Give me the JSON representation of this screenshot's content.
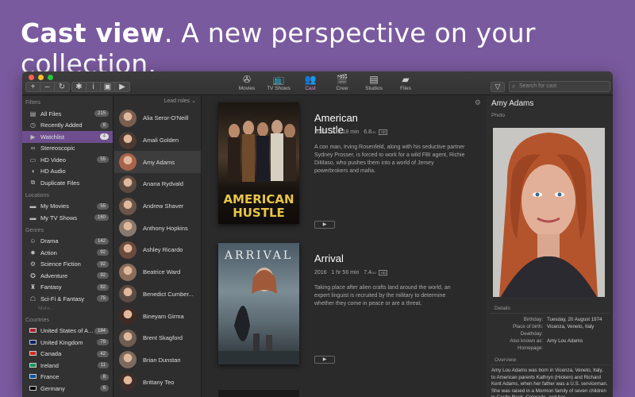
{
  "headline": {
    "bold": "Cast view",
    "rest": ". A new perspective on your collection."
  },
  "toolbar": {
    "left_buttons": [
      "+",
      "–",
      "↻"
    ],
    "right_buttons": [
      "✱",
      "i",
      "▣",
      "▶"
    ],
    "tabs": [
      {
        "label": "Movies",
        "icon": "film-reel-icon",
        "glyph": "✇"
      },
      {
        "label": "TV Shows",
        "icon": "tv-icon",
        "glyph": "📺"
      },
      {
        "label": "Cast",
        "icon": "people-icon",
        "glyph": "👥"
      },
      {
        "label": "Crew",
        "icon": "crew-icon",
        "glyph": "🎬"
      },
      {
        "label": "Studios",
        "icon": "clapper-icon",
        "glyph": "▤"
      },
      {
        "label": "Files",
        "icon": "folder-icon",
        "glyph": "▰"
      }
    ],
    "active_tab": "Cast",
    "search_placeholder": "Search for cast"
  },
  "sidebar": {
    "filters_header": "Filters",
    "filters": [
      {
        "label": "All Files",
        "count": "215",
        "icon": "files-icon",
        "glyph": "▤"
      },
      {
        "label": "Recently Added",
        "count": "8",
        "icon": "clock-icon",
        "glyph": "◷"
      },
      {
        "label": "Watchlist",
        "count": "4",
        "icon": "play-circle-icon",
        "glyph": "▶",
        "selected": true
      },
      {
        "label": "Stereoscopic",
        "count": "",
        "icon": "glasses-icon",
        "glyph": "∞"
      },
      {
        "label": "HD Video",
        "count": "55",
        "icon": "hd-video-icon",
        "glyph": "▭"
      },
      {
        "label": "HD Audio",
        "count": "",
        "icon": "hd-audio-icon",
        "glyph": "◖"
      },
      {
        "label": "Duplicate Files",
        "count": "",
        "icon": "duplicate-icon",
        "glyph": "⧉"
      }
    ],
    "locations_header": "Locations",
    "locations": [
      {
        "label": "My Movies",
        "count": "55",
        "icon": "folder-icon",
        "glyph": "▬"
      },
      {
        "label": "My TV Shows",
        "count": "160",
        "icon": "folder-icon",
        "glyph": "▬"
      }
    ],
    "genres_header": "Genres",
    "genres": [
      {
        "label": "Drama",
        "count": "142",
        "icon": "drama-icon",
        "glyph": "☺"
      },
      {
        "label": "Action",
        "count": "92",
        "icon": "action-icon",
        "glyph": "✸"
      },
      {
        "label": "Science Fiction",
        "count": "92",
        "icon": "scifi-icon",
        "glyph": "⚙"
      },
      {
        "label": "Adventure",
        "count": "92",
        "icon": "compass-icon",
        "glyph": "✪"
      },
      {
        "label": "Fantasy",
        "count": "82",
        "icon": "castle-icon",
        "glyph": "♜"
      },
      {
        "label": "Sci-Fi & Fantasy",
        "count": "75",
        "icon": "robot-icon",
        "glyph": "☖"
      }
    ],
    "genres_more": "More...",
    "countries_header": "Countries",
    "countries": [
      {
        "label": "United States of A...",
        "count": "184",
        "icon": "flag-us-icon",
        "color": "#b22234"
      },
      {
        "label": "United Kingdom",
        "count": "79",
        "icon": "flag-uk-icon",
        "color": "#012169"
      },
      {
        "label": "Canada",
        "count": "42",
        "icon": "flag-ca-icon",
        "color": "#d52b1e"
      },
      {
        "label": "Ireland",
        "count": "11",
        "icon": "flag-ie-icon",
        "color": "#169b62"
      },
      {
        "label": "France",
        "count": "8",
        "icon": "flag-fr-icon",
        "color": "#0055a4"
      },
      {
        "label": "Germany",
        "count": "6",
        "icon": "flag-de-icon",
        "color": "#000000"
      }
    ]
  },
  "castlist": {
    "header": "Lead roles",
    "items": [
      {
        "name": "Alia Seror-O'Neill",
        "color": "#7a5e4e"
      },
      {
        "name": "Amali Golden",
        "color": "#4e3a30"
      },
      {
        "name": "Amy Adams",
        "color": "#a9634a",
        "selected": true
      },
      {
        "name": "Anana Rydvald",
        "color": "#5d4a40"
      },
      {
        "name": "Andrew Shaver",
        "color": "#6a5548"
      },
      {
        "name": "Anthony Hopkins",
        "color": "#8a7a6e"
      },
      {
        "name": "Ashley Ricardo",
        "color": "#6c4b3d"
      },
      {
        "name": "Beatrice Ward",
        "color": "#8c6d5c"
      },
      {
        "name": "Benedict Cumber...",
        "color": "#5c4c44"
      },
      {
        "name": "Bineyam Girma",
        "color": "#3e2a22"
      },
      {
        "name": "Brent Skagford",
        "color": "#6e5d52"
      },
      {
        "name": "Brian Dunstan",
        "color": "#7d6a5e"
      },
      {
        "name": "Brittany Teo",
        "color": "#3e2e29"
      }
    ]
  },
  "movies": [
    {
      "title": "American Hustle",
      "year": "2013",
      "runtime": "2 hr 18 min",
      "rating": "6.8",
      "rating_sup": "/10",
      "badge": "HD",
      "plot": "A con man, Irving Rosenfeld, along with his seductive partner Sydney Prosser, is forced to work for a wild FBI agent, Richie DiMaso, who pushes them into a world of Jersey powerbrokers and mafia.",
      "poster_text": "AMERICAN\nHUSTLE",
      "poster_line1": "AMERICAN",
      "poster_line2": "HUSTLE"
    },
    {
      "title": "Arrival",
      "year": "2016",
      "runtime": "1 hr 56 min",
      "rating": "7.4",
      "rating_sup": "/10",
      "badge": "HD",
      "plot": "Taking place after alien crafts land around the world, an expert linguist is recruited by the military to determine whether they come in peace or are a threat.",
      "poster_text": "ARRIVAL"
    }
  ],
  "detail": {
    "name": "Amy Adams",
    "photo_label": "Photo",
    "details_label": "Details",
    "rows": [
      {
        "k": "Birthday:",
        "v": "Tuesday, 20 August 1974"
      },
      {
        "k": "Place of birth:",
        "v": "Vicenza, Veneto, Italy"
      },
      {
        "k": "Deathday:",
        "v": ""
      },
      {
        "k": "Also known as:",
        "v": "Amy Lou Adams"
      },
      {
        "k": "Homepage:",
        "v": ""
      }
    ],
    "overview_label": "Overview",
    "overview": "Amy Lou Adams was born in Vicenza, Veneto, Italy, to American parents Kathryn (Hicken) and Richard Kent Adams, when her father was a U.S. serviceman. She was raised in a Mormon family of seven children in Castle Rock, Colorado, and has"
  }
}
